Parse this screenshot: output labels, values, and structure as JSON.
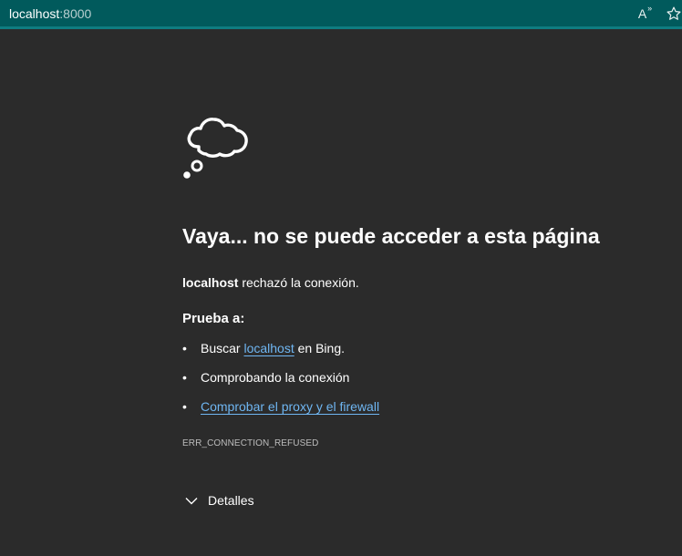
{
  "address_bar": {
    "host": "localhost",
    "port": ":8000"
  },
  "toolbar": {
    "read_aloud_glyph": "A",
    "read_aloud_sub": "»",
    "favorite_glyph": "☆"
  },
  "error_page": {
    "icon": "thought-cloud-icon",
    "title": "Vaya... no se puede acceder a esta página",
    "host_bold": "localhost",
    "host_rest": " rechazó la conexión.",
    "try_label": "Prueba a:",
    "suggestions": [
      {
        "prefix": "Buscar ",
        "link": "localhost",
        "suffix": " en Bing."
      },
      {
        "text": "Comprobando la conexión"
      },
      {
        "link": "Comprobar el proxy y el firewall"
      }
    ],
    "error_code": "ERR_CONNECTION_REFUSED",
    "details_label": "Detalles"
  },
  "colors": {
    "titlebar": "#015a5c",
    "background": "#2b2b2b",
    "link": "#6fb6f2"
  }
}
